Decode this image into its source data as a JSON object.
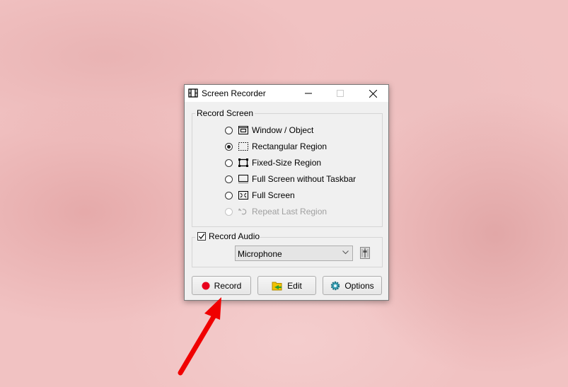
{
  "window": {
    "title": "Screen Recorder",
    "controls": {
      "minimize": "minimize",
      "maximize": "maximize",
      "close": "close"
    }
  },
  "record_screen": {
    "label": "Record Screen",
    "options": [
      {
        "label": "Window / Object",
        "icon": "window-icon",
        "selected": false,
        "enabled": true
      },
      {
        "label": "Rectangular Region",
        "icon": "dashed-rect-icon",
        "selected": true,
        "enabled": true
      },
      {
        "label": "Fixed-Size Region",
        "icon": "fixed-rect-icon",
        "selected": false,
        "enabled": true
      },
      {
        "label": "Full Screen without Taskbar",
        "icon": "screen-no-taskbar-icon",
        "selected": false,
        "enabled": true
      },
      {
        "label": "Full Screen",
        "icon": "fullscreen-icon",
        "selected": false,
        "enabled": true
      },
      {
        "label": "Repeat Last Region",
        "icon": "repeat-icon",
        "selected": false,
        "enabled": false
      }
    ]
  },
  "record_audio": {
    "label": "Record Audio",
    "checked": true,
    "source": "Microphone"
  },
  "buttons": {
    "record": "Record",
    "edit": "Edit",
    "options": "Options"
  },
  "colors": {
    "record_dot": "#e8001c",
    "arrow": "#f00000"
  }
}
